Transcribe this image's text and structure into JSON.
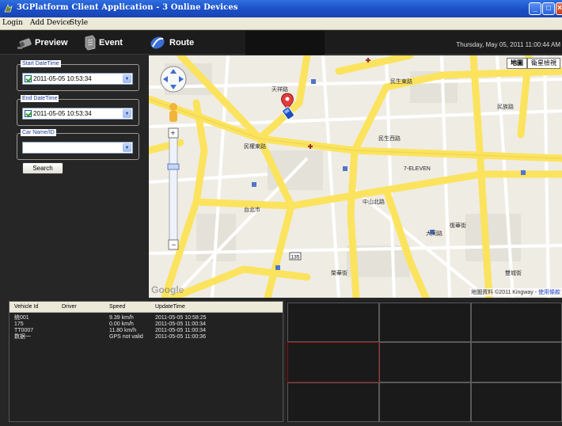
{
  "window": {
    "title": "3GPlatform Client Application - 3 Online Devices",
    "controls": [
      "minimize-icon",
      "maximize-icon",
      "close-icon"
    ]
  },
  "menu": {
    "items": [
      "Login",
      "Add Device",
      "Style"
    ]
  },
  "toolbar": {
    "preview_label": "Preview",
    "event_label": "Event",
    "route_label": "Route",
    "datetime": "Thursday, May 05, 2011 11:00:44 AM"
  },
  "filters": {
    "start": {
      "legend": "Start DateTime",
      "value": "2011-05-05 10:53:34",
      "checked": true
    },
    "end": {
      "legend": "End DateTime",
      "value": "2011-05-05 10:53:34",
      "checked": true
    },
    "car": {
      "legend": "Car Name/ID",
      "value": ""
    },
    "search_label": "Search"
  },
  "map": {
    "type_map": "地圖",
    "type_satellite": "衛星檢視",
    "logo": "Google",
    "attribution": "地圖資料 ©2011 Kingway -",
    "terms_link": "使用條款",
    "labels": [
      "天祥路",
      "民生東路",
      "台北市",
      "7-ELEVEN",
      "復華街",
      "民權東路",
      "大同路",
      "中山北路",
      "民族路",
      "民生西路",
      "榮華街",
      "雙城街"
    ],
    "route_marker": "135"
  },
  "table": {
    "headers": [
      "Vehicle Id",
      "Driver",
      "Speed",
      "UpdateTime"
    ],
    "rows": [
      [
        "统001",
        "",
        "9.39 km/h",
        "2011-05-05 10:58:25"
      ],
      [
        "175",
        "",
        "0.00 km/h",
        "2011-05-05 11:00:34"
      ],
      [
        "TT0007",
        "",
        "11.80 km/h",
        "2011-05-05 11:00:34"
      ],
      [
        "数据一",
        "",
        "GPS not valid",
        "2011-05-05 11:00:36"
      ]
    ]
  },
  "colors": {
    "titlebar": "#1b4fc6",
    "panel": "#262626",
    "road_major": "#fbe35e",
    "selected_cell": "#8b1010"
  }
}
